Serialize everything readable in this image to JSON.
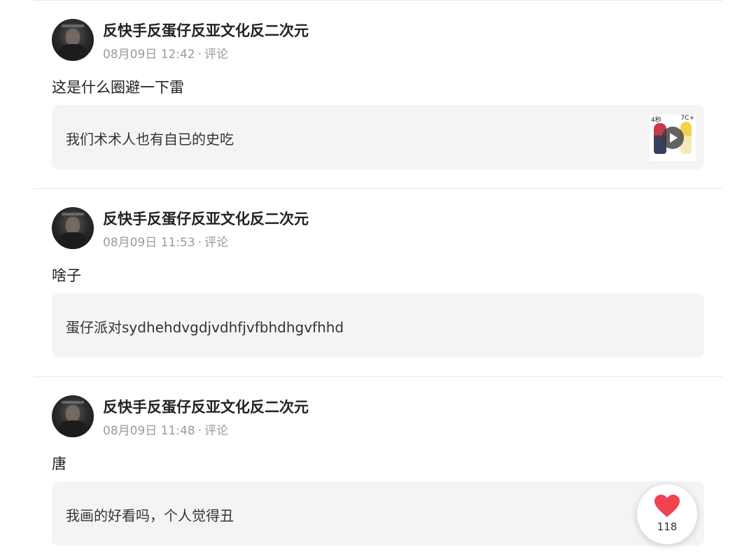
{
  "comments": [
    {
      "username": "反快手反蛋仔反亚文化反二次元",
      "timestamp": "08月09日 12:42",
      "separator": "·",
      "action": "评论",
      "text": "这是什么圈避一下雷",
      "quote": "我们术术人也有自已的史吃",
      "has_video_thumb": true,
      "thumb_tags": [
        "4秒",
        "7C+"
      ]
    },
    {
      "username": "反快手反蛋仔反亚文化反二次元",
      "timestamp": "08月09日 11:53",
      "separator": "·",
      "action": "评论",
      "text": "啥子",
      "quote": "蛋仔派对sydhehdvgdjvdhfjvfbhdhgvfhhd",
      "has_video_thumb": false
    },
    {
      "username": "反快手反蛋仔反亚文化反二次元",
      "timestamp": "08月09日 11:48",
      "separator": "·",
      "action": "评论",
      "text": "唐",
      "quote": "我画的好看吗，个人觉得丑",
      "has_video_thumb": false
    }
  ],
  "like_button": {
    "count": "118",
    "icon": "heart-icon",
    "color": "#f0424f"
  },
  "colors": {
    "card_bg": "#f4f4f4",
    "meta_text": "#9a9a9a",
    "divider": "#e6e6e6"
  }
}
